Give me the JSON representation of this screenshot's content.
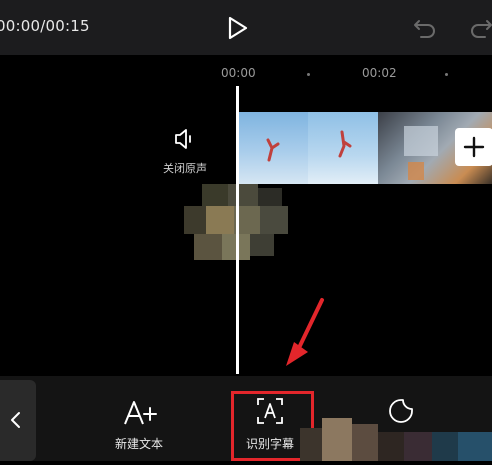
{
  "player": {
    "time_display": "00:00/00:15",
    "play_icon": "play-icon",
    "undo_icon": "undo-icon",
    "redo_icon": "redo-icon"
  },
  "timeline": {
    "ruler_labels": [
      "00:00",
      "00:02"
    ],
    "mute_label": "关闭原声",
    "mute_icon": "speaker-icon",
    "add_clip_icon": "plus-icon"
  },
  "toolbar": {
    "back_icon": "chevron-left-icon",
    "tools": [
      {
        "label": "新建文本",
        "icon": "add-text-icon"
      },
      {
        "label": "识别字幕",
        "icon": "auto-caption-icon"
      },
      {
        "label": "",
        "icon": "sticker-icon"
      }
    ]
  },
  "colors": {
    "highlight": "#e3262b",
    "annotation_arrow": "#e3262b",
    "topbar": "#1c1c1e"
  }
}
